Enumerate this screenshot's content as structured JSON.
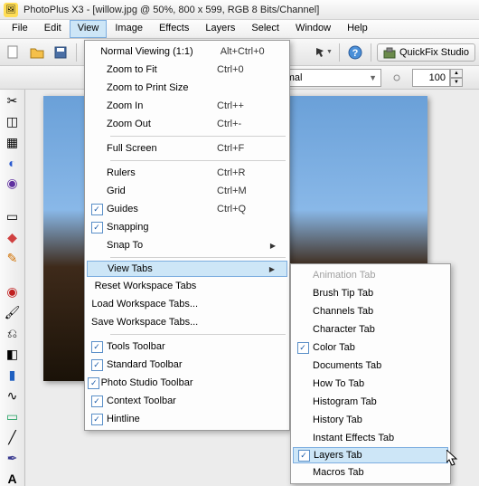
{
  "window": {
    "title": "PhotoPlus X3 - [willow.jpg @ 50%, 800 x 599, RGB 8 Bits/Channel]"
  },
  "menubar": {
    "file": "File",
    "edit": "Edit",
    "view": "View",
    "image": "Image",
    "effects": "Effects",
    "layers": "Layers",
    "select": "Select",
    "window": "Window",
    "help": "Help"
  },
  "toolbar": {
    "quickfix": "QuickFix Studio"
  },
  "options": {
    "blend": "Normal",
    "opacity": "100"
  },
  "view_menu": {
    "normal": "Normal Viewing (1:1)",
    "normal_acc": "Alt+Ctrl+0",
    "zoom_fit": "Zoom to Fit",
    "zoom_fit_acc": "Ctrl+0",
    "zoom_print": "Zoom to Print Size",
    "zoom_in": "Zoom In",
    "zoom_in_acc": "Ctrl++",
    "zoom_out": "Zoom Out",
    "zoom_out_acc": "Ctrl+-",
    "full": "Full Screen",
    "full_acc": "Ctrl+F",
    "rulers": "Rulers",
    "rulers_acc": "Ctrl+R",
    "grid": "Grid",
    "grid_acc": "Ctrl+M",
    "guides": "Guides",
    "guides_acc": "Ctrl+Q",
    "snapping": "Snapping",
    "snap_to": "Snap To",
    "view_tabs": "View Tabs",
    "reset_tabs": "Reset Workspace Tabs",
    "load_tabs": "Load Workspace Tabs...",
    "save_tabs": "Save Workspace Tabs...",
    "tools_tb": "Tools Toolbar",
    "std_tb": "Standard Toolbar",
    "photo_tb": "Photo Studio Toolbar",
    "ctx_tb": "Context Toolbar",
    "hintline": "Hintline"
  },
  "tabs_menu": {
    "animation": "Animation Tab",
    "brush": "Brush Tip Tab",
    "channels": "Channels Tab",
    "character": "Character Tab",
    "color": "Color Tab",
    "documents": "Documents Tab",
    "howto": "How To Tab",
    "histogram": "Histogram Tab",
    "history": "History Tab",
    "instant": "Instant Effects Tab",
    "layers": "Layers Tab",
    "macros": "Macros Tab"
  }
}
